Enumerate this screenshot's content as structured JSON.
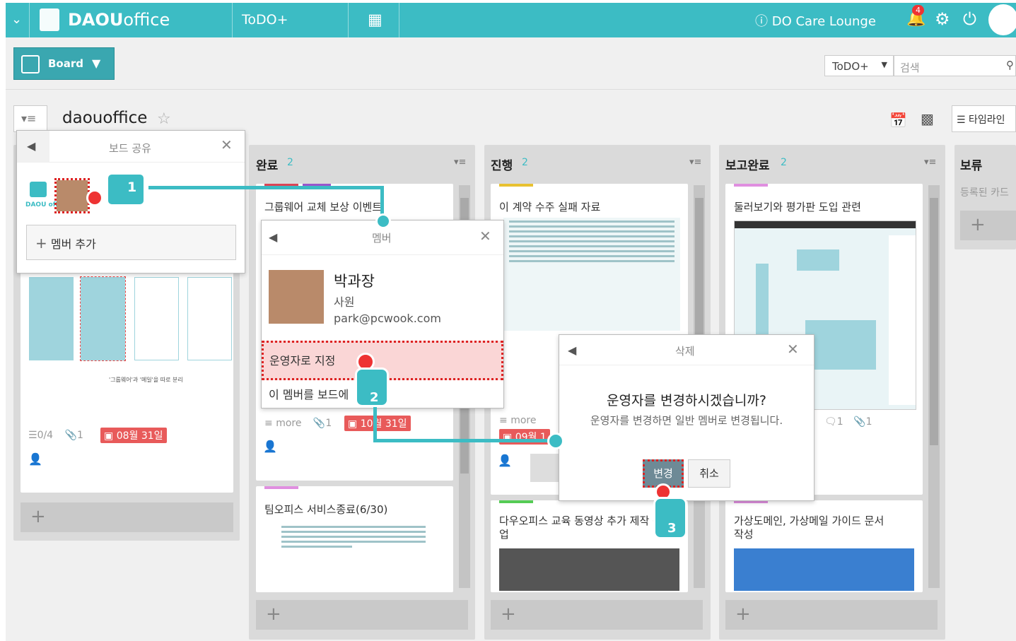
{
  "topbar": {
    "logo_bold": "DAOU",
    "logo_light": "office",
    "app": "ToDO+",
    "care": "DO Care Lounge",
    "badge": "4"
  },
  "toolbar": {
    "board_btn": "Board",
    "scope": "ToDO+",
    "search_placeholder": "검색"
  },
  "board": {
    "title": "daouoffice",
    "timeline": "타임라인"
  },
  "share": {
    "title": "보드 공유",
    "add_member": "멤버 추가",
    "logo_text": "DAOU offi"
  },
  "columns": [
    {
      "title": "완료",
      "count": "2"
    },
    {
      "title": "진행",
      "count": "2"
    },
    {
      "title": "보고완료",
      "count": "2"
    },
    {
      "title": "보류",
      "empty": "등록된 카드"
    }
  ],
  "cards": {
    "c0": {
      "checklist": "0/4",
      "attach": "1",
      "date": "08월 31일",
      "caption": "'그룹웨어'과 '메일'을 따로 분리"
    },
    "c1": {
      "title": "그룹웨어 교체 보상 이벤트",
      "more": "more",
      "attach": "1",
      "date": "10월 31일"
    },
    "c2": {
      "title": "팀오피스 서비스종료(6/30)"
    },
    "c3": {
      "title": "이 계약 수주 실패 자료",
      "more": "more",
      "date": "09월 1"
    },
    "c4": {
      "title": "다우오피스 교육 동영상 추가 제작 작업"
    },
    "c5": {
      "title": "둘러보기와 평가판 도입 관련",
      "comments": "1",
      "attach": "1"
    },
    "c6": {
      "title": "가상도메인, 가상메일 가이드 문서 작성"
    }
  },
  "member": {
    "title": "멤버",
    "name": "박과장",
    "role": "사원",
    "email": "park@pcwook.com",
    "assign": "운영자로 지정",
    "remove": "이 멤버를 보드에"
  },
  "dialog": {
    "title": "삭제",
    "question": "운영자를 변경하시겠습니까?",
    "desc": "운영자를 변경하면 일반 멤버로 변경됩니다.",
    "ok": "변경",
    "cancel": "취소"
  },
  "steps": [
    "1",
    "2",
    "3"
  ]
}
